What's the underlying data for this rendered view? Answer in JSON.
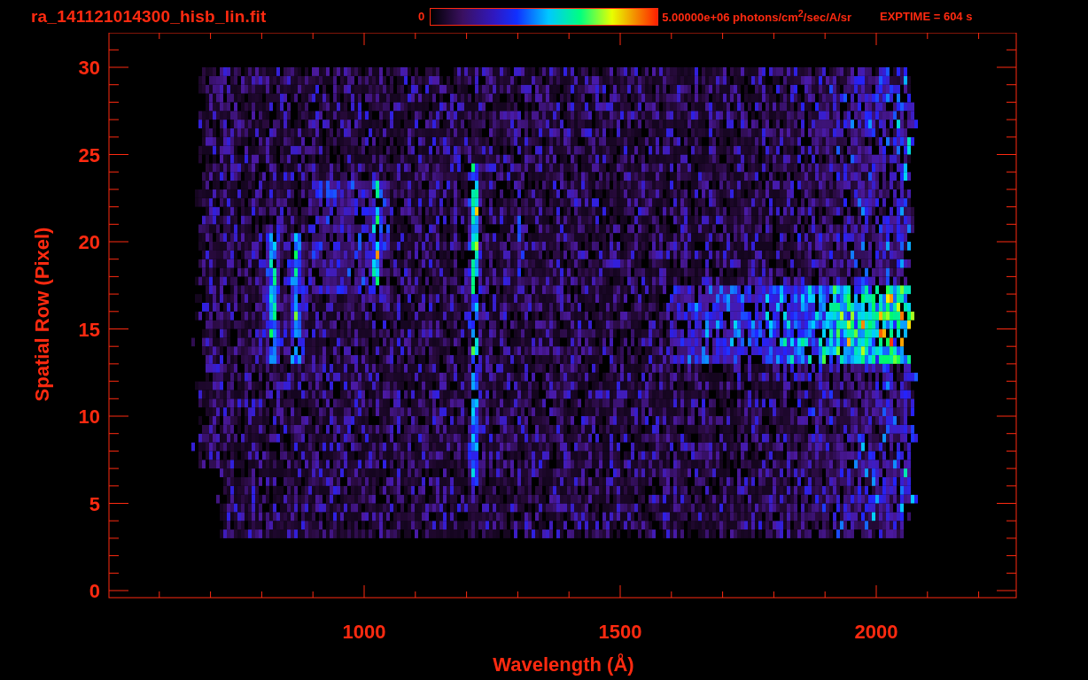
{
  "title": "ra_141121014300_hisb_lin.fit",
  "colorbar": {
    "min_label": "0",
    "max_label": "5.00000e+06 photons/cm$^{2}$/sec/A/sr"
  },
  "exptime": "EXPTIME = 604 s",
  "plot": {
    "xlabel": "Wavelength (Å)",
    "ylabel": "Spatial Row (Pixel)",
    "xticks": [
      "1000",
      "1500",
      "2000"
    ],
    "yticks": [
      "30",
      "25",
      "20",
      "15",
      "10",
      "5",
      "0"
    ]
  }
}
